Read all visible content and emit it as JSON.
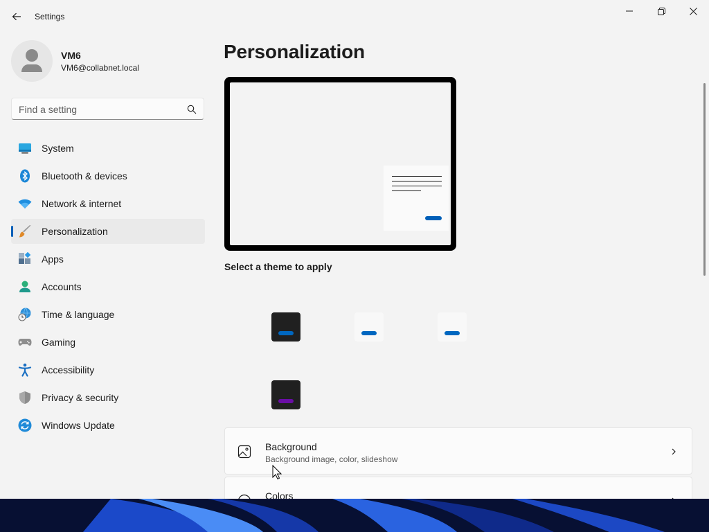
{
  "window": {
    "title": "Settings",
    "controls": [
      "minimize",
      "maximize",
      "close"
    ]
  },
  "profile": {
    "name": "VM6",
    "email": "VM6@collabnet.local"
  },
  "search": {
    "placeholder": "Find a setting",
    "value": ""
  },
  "nav": {
    "items": [
      {
        "label": "System",
        "icon": "system-icon",
        "selected": false
      },
      {
        "label": "Bluetooth & devices",
        "icon": "bluetooth-icon",
        "selected": false
      },
      {
        "label": "Network & internet",
        "icon": "wifi-icon",
        "selected": false
      },
      {
        "label": "Personalization",
        "icon": "brush-icon",
        "selected": true
      },
      {
        "label": "Apps",
        "icon": "apps-icon",
        "selected": false
      },
      {
        "label": "Accounts",
        "icon": "person-icon",
        "selected": false
      },
      {
        "label": "Time & language",
        "icon": "globe-clock-icon",
        "selected": false
      },
      {
        "label": "Gaming",
        "icon": "gamepad-icon",
        "selected": false
      },
      {
        "label": "Accessibility",
        "icon": "accessibility-icon",
        "selected": false
      },
      {
        "label": "Privacy & security",
        "icon": "shield-icon",
        "selected": false
      },
      {
        "label": "Windows Update",
        "icon": "update-icon",
        "selected": false
      }
    ]
  },
  "main": {
    "title": "Personalization",
    "theme_heading": "Select a theme to apply",
    "themes": [
      {
        "name": "dark-blue",
        "bg": "#202020",
        "accent": "#0067c0"
      },
      {
        "name": "light-blue-1",
        "bg": "#f8f8f8",
        "accent": "#0067c0"
      },
      {
        "name": "light-blue-2",
        "bg": "#f8f8f8",
        "accent": "#0067c0"
      },
      {
        "name": "dark-purple",
        "bg": "#202020",
        "accent": "#6a0ea6"
      }
    ],
    "cards": [
      {
        "title": "Background",
        "subtitle": "Background image, color, slideshow",
        "icon": "image-icon"
      },
      {
        "title": "Colors",
        "subtitle": "",
        "icon": "palette-icon"
      }
    ]
  },
  "colors": {
    "accent": "#005fb8",
    "window_bg": "#f3f3f3",
    "selected_nav_bg": "#eaeaea"
  }
}
